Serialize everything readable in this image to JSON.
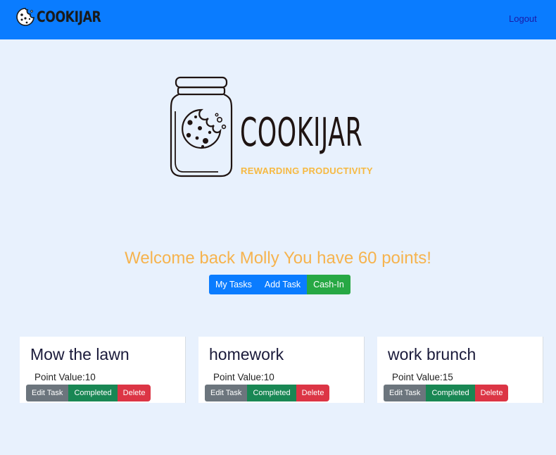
{
  "navbar": {
    "brand_text": "COOKIJAR",
    "logout_label": "Logout",
    "background": "#0a7cff"
  },
  "hero": {
    "title": "COOKIJAR",
    "tagline": "REWARDING PRODUCTIVITY",
    "tagline_color": "#f6b942"
  },
  "welcome": {
    "message": "Welcome back Molly You have 60 points!",
    "color": "#f6b34e"
  },
  "actions": {
    "my_tasks_label": "My Tasks",
    "add_task_label": "Add Task",
    "cash_in_label": "Cash-In"
  },
  "tasks": [
    {
      "title": "Mow the lawn",
      "points_text": "Point Value:10",
      "points": 10
    },
    {
      "title": "homework",
      "points_text": "Point Value:10",
      "points": 10
    },
    {
      "title": "work brunch",
      "points_text": "Point Value:15",
      "points": 15
    }
  ],
  "task_buttons": {
    "edit_label": "Edit Task",
    "complete_label": "Completed",
    "delete_label": "Delete"
  },
  "colors": {
    "page_background": "#e8f1fd",
    "primary": "#0a7cff",
    "success": "#27a844",
    "secondary": "#6c757d",
    "danger": "#dc3545"
  }
}
